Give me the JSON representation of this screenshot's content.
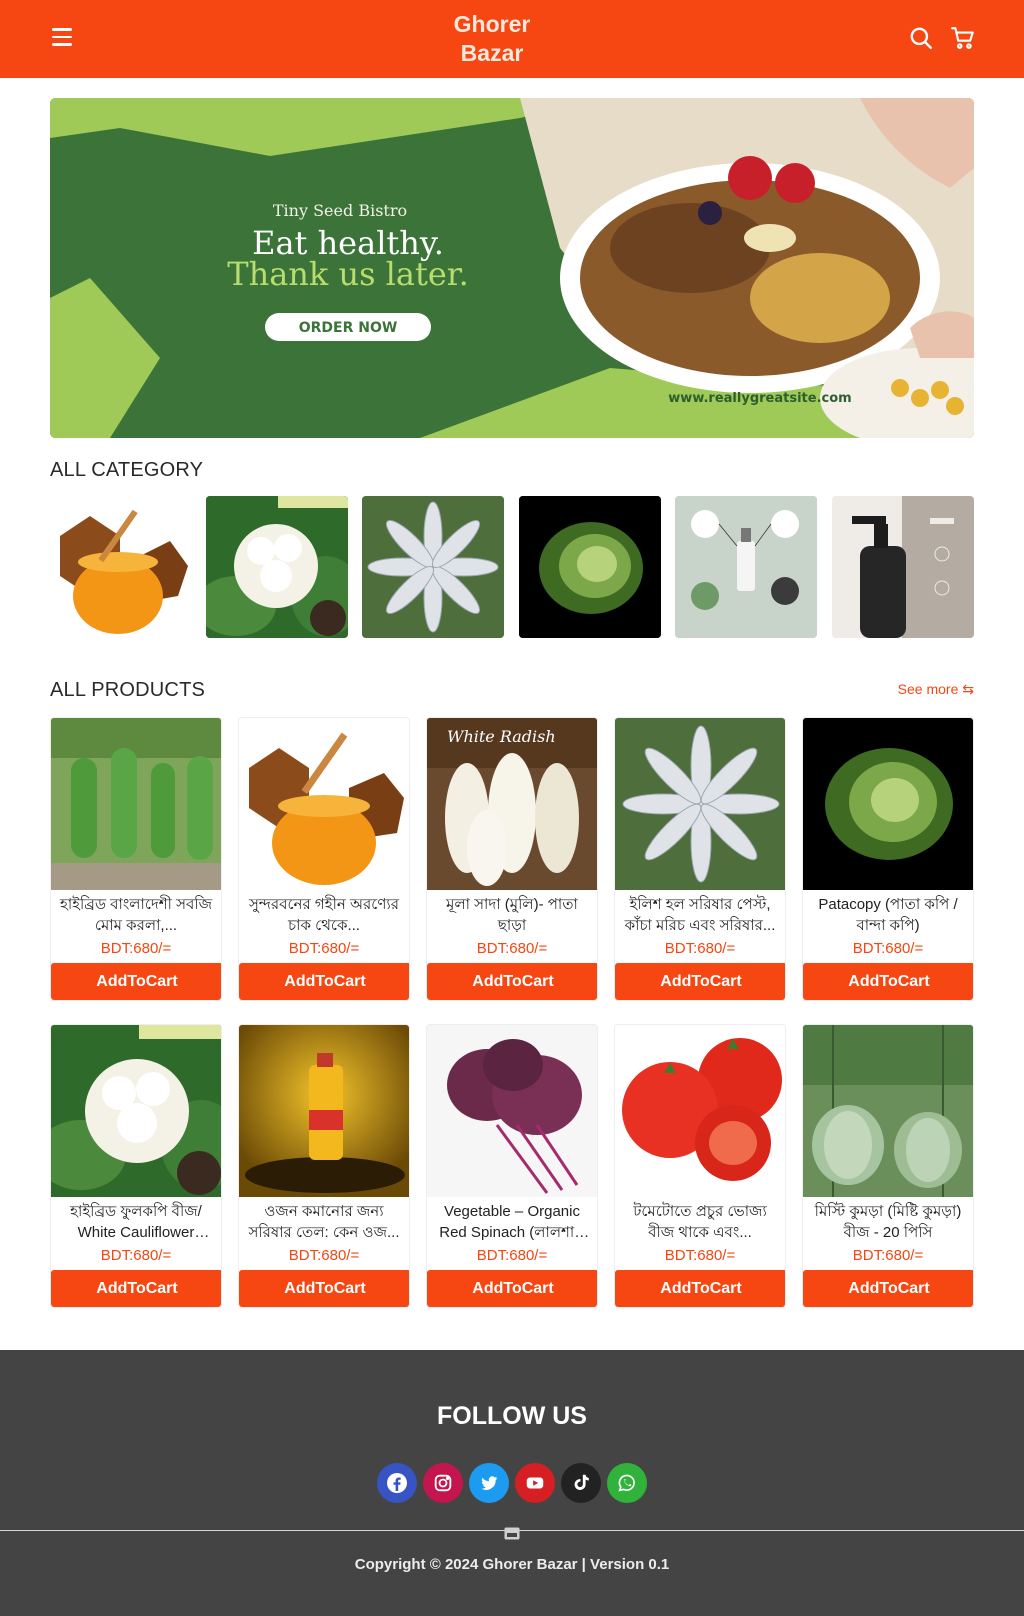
{
  "header": {
    "title_line1": "Ghorer",
    "title_line2": "Bazar",
    "icons": [
      "menu-icon",
      "search-icon",
      "cart-icon"
    ],
    "brand_color": "#f64612"
  },
  "banner": {
    "brand": "Tiny Seed Bistro",
    "headline1": "Eat healthy.",
    "headline2": "Thank us later.",
    "cta": "ORDER NOW",
    "website": "www.reallygreatsite.com"
  },
  "categories": {
    "title": "ALL CATEGORY",
    "items": [
      "honey",
      "cauliflower",
      "hilsa-fish",
      "cabbage",
      "skincare-serum",
      "soap-dispenser"
    ]
  },
  "products": {
    "title": "ALL PRODUCTS",
    "see_more": "See more ⇆",
    "add_label": "AddToCart",
    "items": [
      {
        "name": "হাইব্রিড বাংলাদেশী সবজি মোম করলা,...",
        "price": "BDT:680/="
      },
      {
        "name": "সুন্দরবনের গহীন অরণ্যের চাক থেকে...",
        "price": "BDT:680/="
      },
      {
        "name": "মূলা সাদা (মুলি)- পাতা ছাড়া",
        "price": "BDT:680/="
      },
      {
        "name": "ইলিশ হল সরিষার পেস্ট, কাঁচা মরিচ এবং সরিষার...",
        "price": "BDT:680/="
      },
      {
        "name": "Patacopy (পাতা কপি / বান্দা কপি)",
        "price": "BDT:680/="
      },
      {
        "name": "হাইব্রিড ফুলকপি বীজ/ White Cauliflower Seed...",
        "price": "BDT:680/="
      },
      {
        "name": "ওজন কমানোর জন্য সরিষার তেল: কেন ওজ...",
        "price": "BDT:680/="
      },
      {
        "name": "Vegetable – Organic Red Spinach (লালশাক –...",
        "price": "BDT:680/="
      },
      {
        "name": "টমেটোতে প্রচুর ভোজ্য বীজ থাকে এবং...",
        "price": "BDT:680/="
      },
      {
        "name": "মিস্টি কুমড়া (মিষ্টি কুমড়া) বীজ - 20 পিসি",
        "price": "BDT:680/="
      }
    ]
  },
  "footer": {
    "follow_title": "FOLLOW US",
    "social": [
      "facebook-icon",
      "instagram-icon",
      "twitter-icon",
      "youtube-icon",
      "tiktok-icon",
      "whatsapp-icon"
    ],
    "copyright": "Copyright © 2024 Ghorer Bazar | Version 0.1"
  }
}
